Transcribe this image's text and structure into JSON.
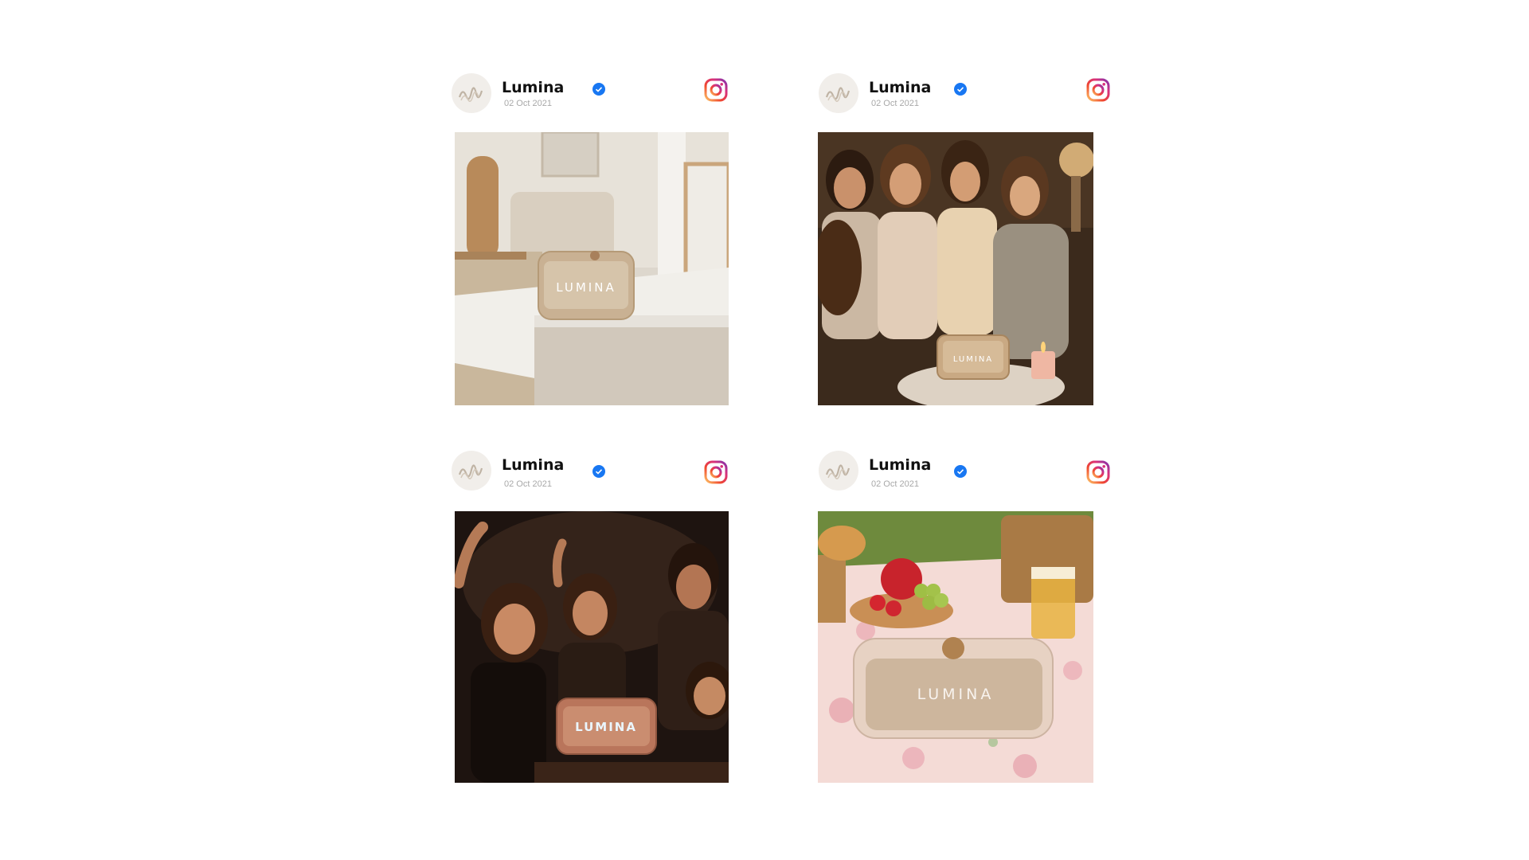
{
  "posts": [
    {
      "account_name": "Lumina",
      "date": "02 Oct 2021",
      "image_text": "LUMINA",
      "icon": "instagram-icon",
      "scene": "living-room"
    },
    {
      "account_name": "Lumina",
      "date": "02 Oct 2021",
      "image_text": "LUMINA",
      "icon": "instagram-icon",
      "scene": "friends-evening"
    },
    {
      "account_name": "Lumina",
      "date": "02 Oct 2021",
      "image_text": "LUMINA",
      "icon": "instagram-icon",
      "scene": "party"
    },
    {
      "account_name": "Lumina",
      "date": "02 Oct 2021",
      "image_text": "LUMINA",
      "icon": "instagram-icon",
      "scene": "picnic"
    }
  ],
  "colors": {
    "verified": "#1877f2",
    "ig_gradient_start": "#f58529",
    "ig_gradient_end": "#8134af"
  }
}
